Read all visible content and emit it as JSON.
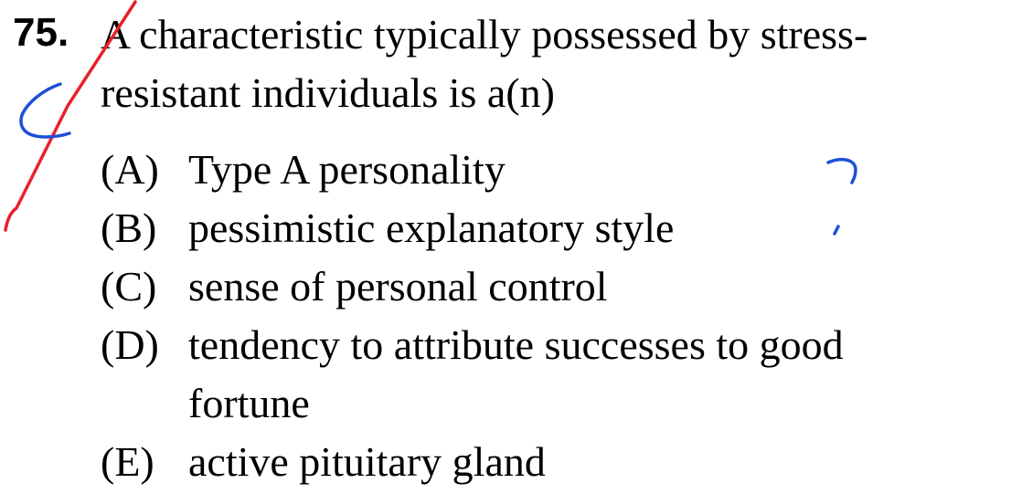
{
  "question": {
    "number": "75.",
    "stem": "A characteristic typically possessed by stress-resistant individuals is a(n)"
  },
  "options": [
    {
      "letter": "(A)",
      "text": "Type A personality"
    },
    {
      "letter": "(B)",
      "text": "pessimistic explanatory style"
    },
    {
      "letter": "(C)",
      "text": "sense of personal control"
    },
    {
      "letter": "(D)",
      "text": "tendency to attribute successes to good fortune"
    },
    {
      "letter": "(E)",
      "text": "active pituitary gland"
    }
  ],
  "annotations": {
    "check_mark_color": "#e8202a",
    "handwriting_color": "#1f4fd8"
  }
}
